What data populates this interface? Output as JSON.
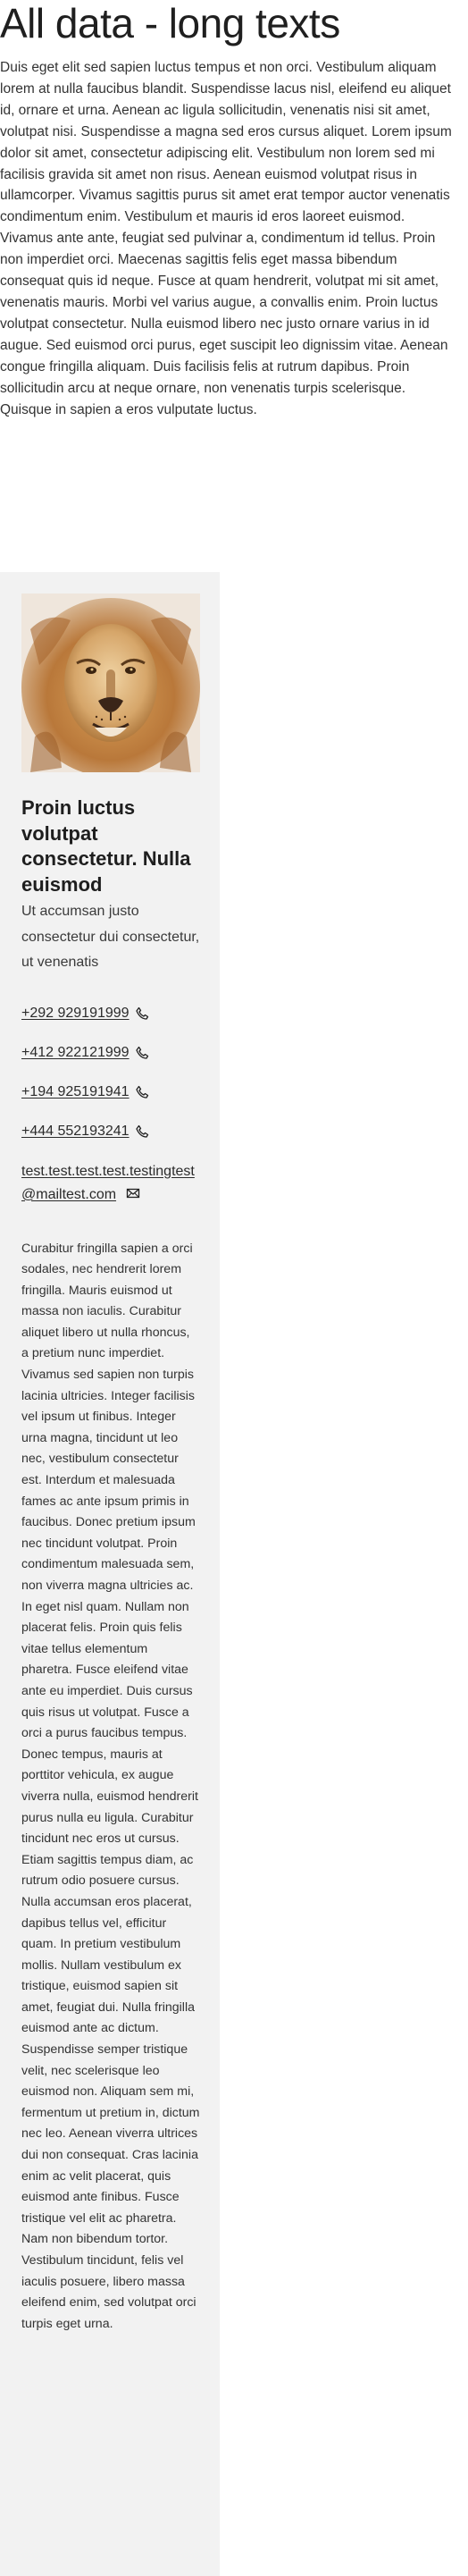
{
  "page": {
    "title": "All data - long texts",
    "intro": "Duis eget elit sed sapien luctus tempus et non orci. Vestibulum aliquam lorem at nulla faucibus blandit. Suspendisse lacus nisl, eleifend eu aliquet id, ornare et urna. Aenean ac ligula sollicitudin, venenatis nisi sit amet, volutpat nisi. Suspendisse a magna sed eros cursus aliquet. Lorem ipsum dolor sit amet, consectetur adipiscing elit. Vestibulum non lorem sed mi facilisis gravida sit amet non risus. Aenean euismod volutpat risus in ullamcorper. Vivamus sagittis purus sit amet erat tempor auctor venenatis condimentum enim. Vestibulum et mauris id eros laoreet euismod. Vivamus ante ante, feugiat sed pulvinar a, condimentum id tellus. Proin non imperdiet orci. Maecenas sagittis felis eget massa bibendum consequat quis id neque. Fusce at quam hendrerit, volutpat mi sit amet, venenatis mauris. Morbi vel varius augue, a convallis enim. Proin luctus volutpat consectetur. Nulla euismod libero nec justo ornare varius in id augue. Sed euismod orci purus, eget suscipit leo dignissim vitae. Aenean congue fringilla aliquam. Duis facilisis felis at rutrum dapibus. Proin sollicitudin arcu at neque ornare, non venenatis turpis scelerisque. Quisque in sapien a eros vulputate luctus."
  },
  "card": {
    "image_icon": "lion-portrait",
    "name": "Proin luctus volutpat consectetur. Nulla euismod",
    "subtitle": "Ut accumsan justo consectetur dui consectetur, ut venenatis",
    "phones": [
      {
        "number": "+292 929191999",
        "icon": "phone-icon"
      },
      {
        "number": "+412 922121999",
        "icon": "phone-icon"
      },
      {
        "number": "+194 925191941",
        "icon": "phone-icon"
      },
      {
        "number": "+444 552193241",
        "icon": "phone-icon"
      }
    ],
    "email": "test.test.test.test.testingtest@mailtest.com",
    "email_icon": "envelope-icon",
    "description": "Curabitur fringilla sapien a orci sodales, nec hendrerit lorem fringilla. Mauris euismod ut massa non iaculis. Curabitur aliquet libero ut nulla rhoncus, a pretium nunc imperdiet. Vivamus sed sapien non turpis lacinia ultricies. Integer facilisis vel ipsum ut finibus. Integer urna magna, tincidunt ut leo nec, vestibulum consectetur est. Interdum et malesuada fames ac ante ipsum primis in faucibus. Donec pretium ipsum nec tincidunt volutpat. Proin condimentum malesuada sem, non viverra magna ultricies ac. In eget nisl quam. Nullam non placerat felis. Proin quis felis vitae tellus elementum pharetra. Fusce eleifend vitae ante eu imperdiet. Duis cursus quis risus ut volutpat. Fusce a orci a purus faucibus tempus. Donec tempus, mauris at porttitor vehicula, ex augue viverra nulla, euismod hendrerit purus nulla eu ligula. Curabitur tincidunt nec eros ut cursus. Etiam sagittis tempus diam, ac rutrum odio posuere cursus. Nulla accumsan eros placerat, dapibus tellus vel, efficitur quam. In pretium vestibulum mollis. Nullam vestibulum ex tristique, euismod sapien sit amet, feugiat dui. Nulla fringilla euismod ante ac dictum. Suspendisse semper tristique velit, nec scelerisque leo euismod non. Aliquam sem mi, fermentum ut pretium in, dictum nec leo. Aenean viverra ultrices dui non consequat. Cras lacinia enim ac velit placerat, quis euismod ante finibus. Fusce tristique vel elit ac pharetra. Nam non bibendum tortor. Vestibulum tincidunt, felis vel iaculis posuere, libero massa eleifend enim, sed volutpat orci turpis eget urna."
  }
}
